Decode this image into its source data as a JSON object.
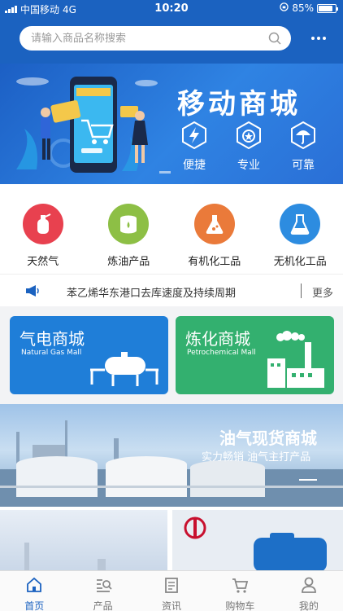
{
  "status_bar": {
    "carrier": "中国移动",
    "network": "4G",
    "time": "10:20",
    "battery": "85%"
  },
  "search": {
    "placeholder": "请输入商品名称搜索"
  },
  "banner": {
    "title": "移动商城",
    "badges": [
      {
        "label": "便捷",
        "icon": "lightning-icon"
      },
      {
        "label": "专业",
        "icon": "star-medal-icon"
      },
      {
        "label": "可靠",
        "icon": "umbrella-icon"
      }
    ]
  },
  "categories": [
    {
      "label": "天然气",
      "icon": "gas-cylinder-icon",
      "color": "#e8414f"
    },
    {
      "label": "炼油产品",
      "icon": "oil-barrel-icon",
      "color": "#8dbf45"
    },
    {
      "label": "有机化工品",
      "icon": "flask-icon",
      "color": "#ea7a3a"
    },
    {
      "label": "无机化工品",
      "icon": "beaker-icon",
      "color": "#2d8ce0"
    }
  ],
  "notice": {
    "text": "苯乙烯华东港口去库速度及持续周期",
    "more": "更多"
  },
  "malls": [
    {
      "title": "气电商城",
      "subtitle": "Natural Gas Mall",
      "color": "#1f7ed8"
    },
    {
      "title": "炼化商城",
      "subtitle": "Petrochemical Mall",
      "color": "#33b06f"
    }
  ],
  "oil_banner": {
    "title": "油气现货商城",
    "subtitle": "实力畅销  油气主打产品"
  },
  "tabbar": [
    {
      "label": "首页",
      "icon": "home-icon",
      "active": true
    },
    {
      "label": "产品",
      "icon": "product-icon",
      "active": false
    },
    {
      "label": "资讯",
      "icon": "news-icon",
      "active": false
    },
    {
      "label": "购物车",
      "icon": "cart-icon",
      "active": false
    },
    {
      "label": "我的",
      "icon": "user-icon",
      "active": false
    }
  ],
  "colors": {
    "primary": "#1b62c0",
    "tab_active": "#1b62c0"
  }
}
